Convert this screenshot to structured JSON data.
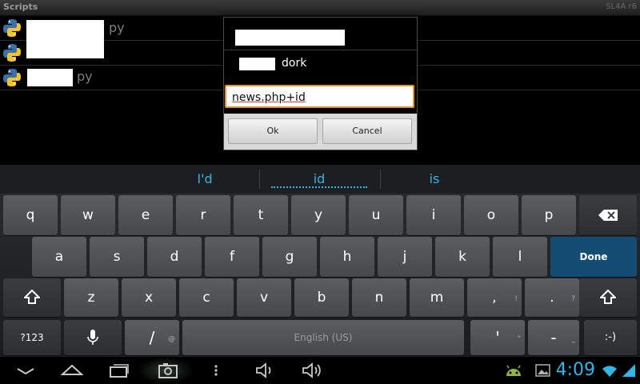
{
  "app": {
    "title": "Scripts",
    "version": "SL4A r6"
  },
  "scripts": [
    {
      "ext": "py"
    },
    {
      "ext": ""
    },
    {
      "ext": "py"
    }
  ],
  "dialog": {
    "message": "dork",
    "input_value": "news.php+id",
    "ok_label": "Ok",
    "cancel_label": "Cancel"
  },
  "keyboard": {
    "suggestions": [
      "I'd",
      "id",
      "is"
    ],
    "row1": [
      "q",
      "w",
      "e",
      "r",
      "t",
      "y",
      "u",
      "i",
      "o",
      "p"
    ],
    "row2": [
      "a",
      "s",
      "d",
      "f",
      "g",
      "h",
      "j",
      "k",
      "l"
    ],
    "row3": [
      "z",
      "x",
      "c",
      "v",
      "b",
      "n",
      "m",
      ",",
      "."
    ],
    "row3_hints": [
      "",
      "",
      "",
      "",
      "",
      "",
      "",
      "!",
      "?"
    ],
    "done_label": "Done",
    "symbols_label": "?123",
    "slash_label": "/",
    "slash_hint": "@",
    "space_label": "English (US)",
    "apostrophe_label": "'",
    "apostrophe_hint": "\"",
    "dash_label": "-",
    "dash_hint": "_",
    "smiley_label": ":-)"
  },
  "status": {
    "time": "4:09"
  },
  "colors": {
    "accent": "#33b5e5",
    "done_key": "#134d73",
    "input_border": "#e8931c"
  }
}
